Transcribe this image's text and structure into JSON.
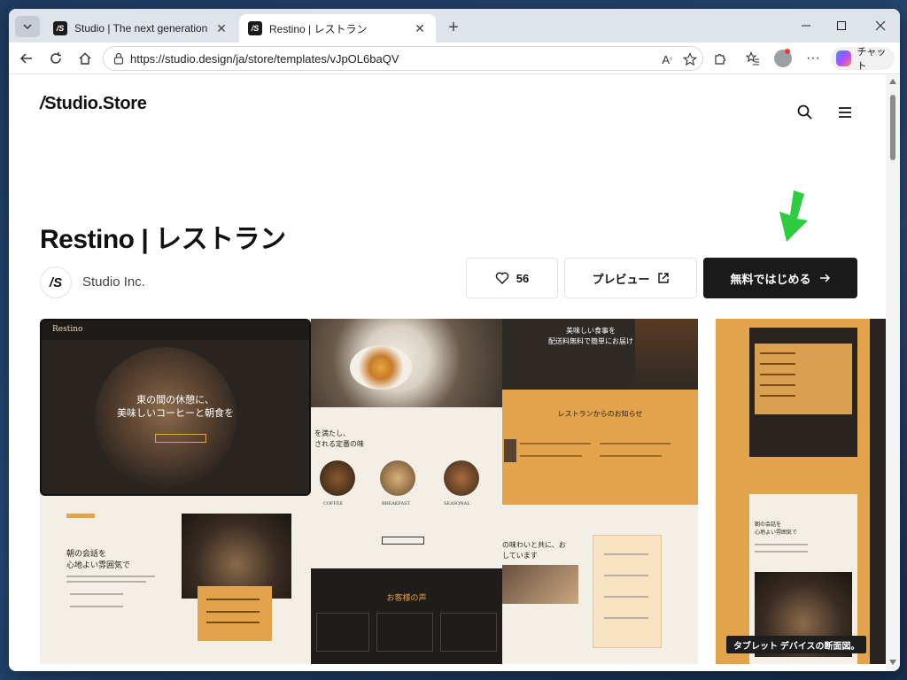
{
  "browser": {
    "tabs": [
      {
        "title": "Studio | The next generation desig",
        "favicon": "/S",
        "active": false
      },
      {
        "title": "Restino | レストラン",
        "favicon": "/S",
        "active": true
      }
    ],
    "url": "https://studio.design/ja/store/templates/vJpOL6baQV",
    "copilot_label": "チャット"
  },
  "site": {
    "brand": "Studio.Store"
  },
  "product": {
    "title": "Restino | レストラン",
    "author_logo": "/S",
    "author": "Studio Inc.",
    "likes": "56",
    "preview_label": "プレビュー",
    "start_label": "無料ではじめる"
  },
  "preview": {
    "hero_line1": "東の間の休憩に、",
    "hero_line2": "美味しいコーヒーと朝食を",
    "nav_brand": "Restino",
    "news_title": "レストランからのお知らせ",
    "delivery_line1": "美味しい食事を",
    "delivery_line2": "配送料無料で簡単にお届け",
    "morning_line1": "朝の会話を",
    "morning_line2": "心地よい雰囲気で",
    "menu_heading_a": "を満たし、",
    "menu_heading_b": "される定番の味",
    "menu_items": [
      "COFFEE",
      "BREAKFAST",
      "SEASONAL"
    ],
    "taste_line1": "の味わいと共に、お",
    "taste_line2": "しています",
    "voice_title": "お客様の声",
    "side_heading1": "朝の会話を",
    "side_heading2": "心地よい雰囲気で",
    "side_caption": "タブレット デバイスの断面図。"
  },
  "colors": {
    "accent": "#e2a34a",
    "dark": "#1f1c19",
    "cream": "#f3efe7",
    "green_arrow": "#2ecc40"
  }
}
